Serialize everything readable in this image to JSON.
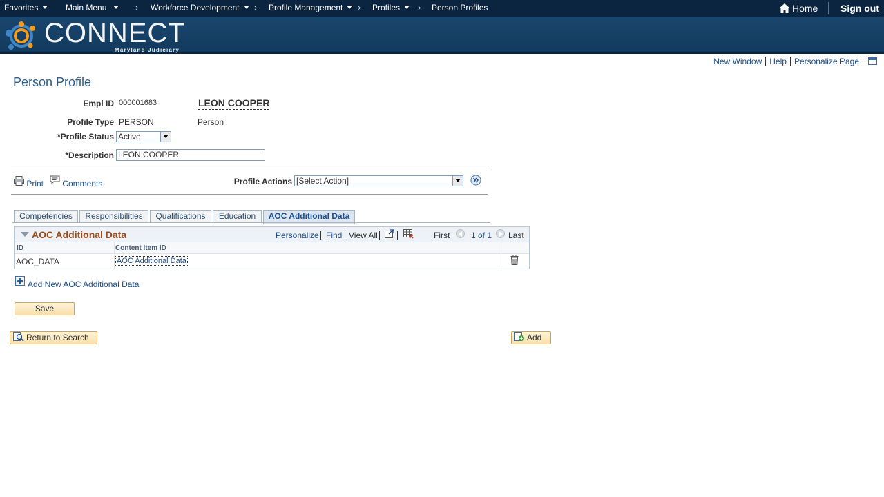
{
  "topnav": {
    "favorites": "Favorites",
    "main_menu": "Main Menu",
    "breadcrumbs": [
      "Workforce Development",
      "Profile Management",
      "Profiles",
      "Person Profiles"
    ],
    "home": "Home",
    "signout": "Sign out"
  },
  "banner": {
    "logo_text": "CONNECT",
    "logo_sub": "Maryland Judiciary"
  },
  "pagelinks": {
    "new_window": "New Window",
    "help": "Help",
    "personalize": "Personalize Page"
  },
  "page_title": "Person Profile",
  "form": {
    "empl_id_label": "Empl ID",
    "empl_id": "000001683",
    "name": "LEON COOPER",
    "profile_type_label": "Profile Type",
    "profile_type": "PERSON",
    "profile_type_desc": "Person",
    "profile_status_label": "*Profile Status",
    "profile_status": "Active",
    "description_label": "*Description",
    "description": "LEON COOPER"
  },
  "actions": {
    "print": "Print",
    "comments": "Comments",
    "profile_actions_label": "Profile Actions",
    "profile_actions_value": "[Select Action]"
  },
  "tabs": [
    "Competencies",
    "Responsibilities",
    "Qualifications",
    "Education",
    "AOC Additional Data"
  ],
  "grid": {
    "title": "AOC Additional Data",
    "personalize": "Personalize",
    "find": "Find",
    "view_all": "View All",
    "first": "First",
    "page": "1 of 1",
    "last": "Last",
    "col_id": "ID",
    "col_content": "Content Item ID",
    "rows": [
      {
        "id": "AOC_DATA",
        "content": "AOC Additional Data"
      }
    ]
  },
  "add_new": "Add New AOC Additional Data",
  "buttons": {
    "save": "Save",
    "return": "Return to Search",
    "add": "Add"
  },
  "colors": {
    "nav_bg": "#0b2540",
    "banner_bg": "#1a466e",
    "link": "#1d4f91",
    "grid_title": "#9a4d1c"
  }
}
